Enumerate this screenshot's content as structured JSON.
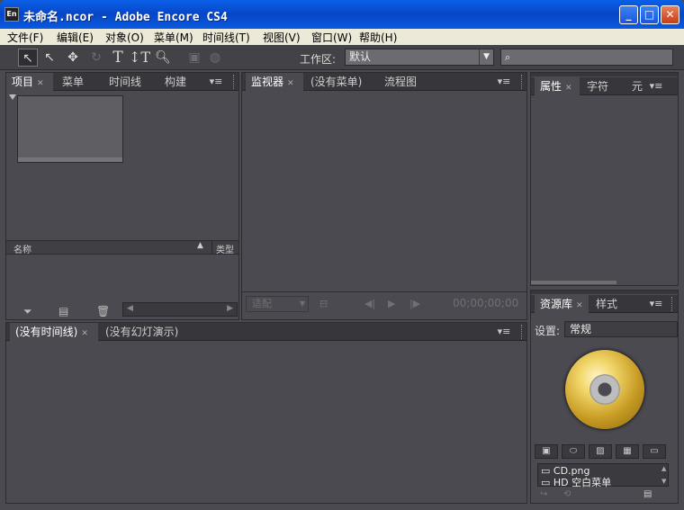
{
  "window": {
    "app_icon": "En",
    "title": "未命名.ncor - Adobe Encore CS4",
    "minimize": "_",
    "maximize": "□",
    "close": "✕"
  },
  "menubar": [
    "文件(F)",
    "编辑(E)",
    "对象(O)",
    "菜单(M)",
    "时间线(T)",
    "视图(V)",
    "窗口(W)",
    "帮助(H)"
  ],
  "toolbar": {
    "workspace_label": "工作区:",
    "workspace_value": "默认",
    "search_icon": "search-icon",
    "tools": [
      "selection-icon",
      "direct-select-icon",
      "move-icon",
      "rotate-icon",
      "text-icon",
      "vertical-text-icon",
      "zoom-icon",
      "preview-icon",
      "globe-icon"
    ]
  },
  "project_panel": {
    "tabs": [
      "项目",
      "菜单",
      "时间线",
      "构建"
    ],
    "columns": {
      "name": "名称",
      "type": "类型"
    },
    "bottom_icons": [
      "filter-icon",
      "new-item-icon",
      "delete-icon"
    ]
  },
  "monitor_panel": {
    "tabs": [
      "监视器",
      "(没有菜单)",
      "流程图"
    ],
    "fit_label": "适配",
    "timecode": "00;00;00;00"
  },
  "properties_panel": {
    "tabs": [
      "属性",
      "字符",
      "元"
    ]
  },
  "timeline_panel": {
    "tabs": [
      "(没有时间线)",
      "(没有幻灯演示)"
    ]
  },
  "library_panel": {
    "tabs": [
      "资源库",
      "样式"
    ],
    "settings_label": "设置:",
    "settings_value": "常规",
    "items": [
      "CD.png",
      "HD 空白菜单"
    ]
  },
  "colors": {
    "titlebar": "#0a54dc",
    "panel": "#4b4a50",
    "menubar": "#ece9d8"
  }
}
